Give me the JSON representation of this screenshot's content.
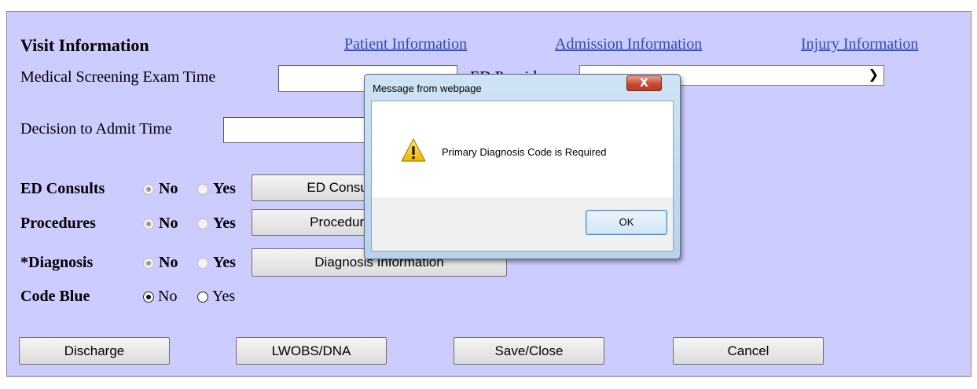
{
  "header": {
    "title": "Visit Information",
    "links": [
      "Patient Information",
      "Admission Information",
      "Injury Information"
    ]
  },
  "fields": {
    "mse_label": "Medical Screening Exam Time",
    "mse_value": "",
    "provider_label": "ED Provider",
    "provider_value": "",
    "dta_label": "Decision to Admit Time",
    "dta_value": ""
  },
  "rows": {
    "ed_consults": {
      "label": "ED Consults",
      "no": "No",
      "yes": "Yes",
      "selected": "No",
      "button": "ED Consults Information"
    },
    "procedures": {
      "label": "Procedures",
      "no": "No",
      "yes": "Yes",
      "selected": "No",
      "button": "Procedures Information"
    },
    "diagnosis": {
      "label": "*Diagnosis",
      "no": "No",
      "yes": "Yes",
      "selected": "No",
      "button": "Diagnosis Information"
    },
    "code_blue": {
      "label": "Code Blue",
      "no": "No",
      "yes": "Yes",
      "selected": "No"
    }
  },
  "buttons": {
    "discharge": "Discharge",
    "lwobs": "LWOBS/DNA",
    "save_close": "Save/Close",
    "cancel": "Cancel"
  },
  "dialog": {
    "title": "Message from webpage",
    "message": "Primary Diagnosis Code is Required",
    "ok": "OK",
    "close_glyph": "X",
    "icon": "warning-icon"
  },
  "colors": {
    "panel_bg": "#ccccff",
    "link": "#2a4fb8"
  }
}
